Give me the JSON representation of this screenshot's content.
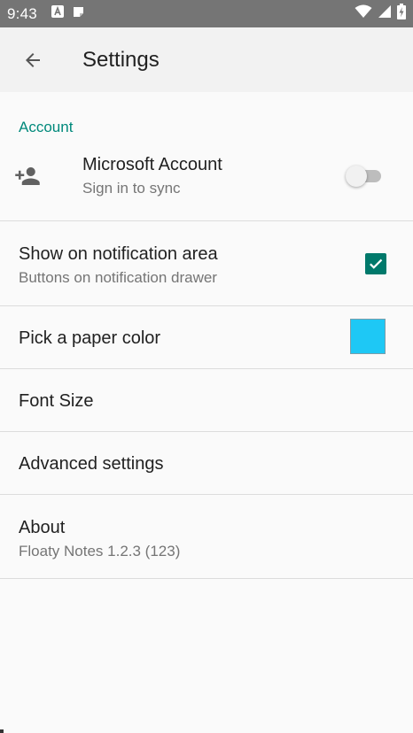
{
  "status_bar": {
    "time": "9:43",
    "notification_icons": [
      "font-a-icon",
      "note-icon"
    ],
    "system_icons": [
      "wifi-icon",
      "signal-icon",
      "battery-icon"
    ]
  },
  "app_bar": {
    "title": "Settings",
    "back_icon": "arrow-back-icon"
  },
  "account_section": {
    "header": "Account",
    "microsoft_account": {
      "title": "Microsoft Account",
      "summary": "Sign in to sync",
      "icon": "person-add-icon",
      "enabled": false
    }
  },
  "preferences": {
    "notification_area": {
      "title": "Show on notification area",
      "summary": "Buttons on notification drawer",
      "checked": true
    },
    "paper_color": {
      "title": "Pick a paper color",
      "color": "#1ec8f5"
    },
    "font_size": {
      "title": "Font Size"
    },
    "advanced": {
      "title": "Advanced settings"
    },
    "about": {
      "title": "About",
      "summary": "Floaty Notes 1.2.3 (123)"
    }
  },
  "colors": {
    "accent": "#00897b",
    "checkbox": "#00796b",
    "status_bar": "#757575",
    "app_bar": "#f2f2f2",
    "background": "#fafafa"
  }
}
